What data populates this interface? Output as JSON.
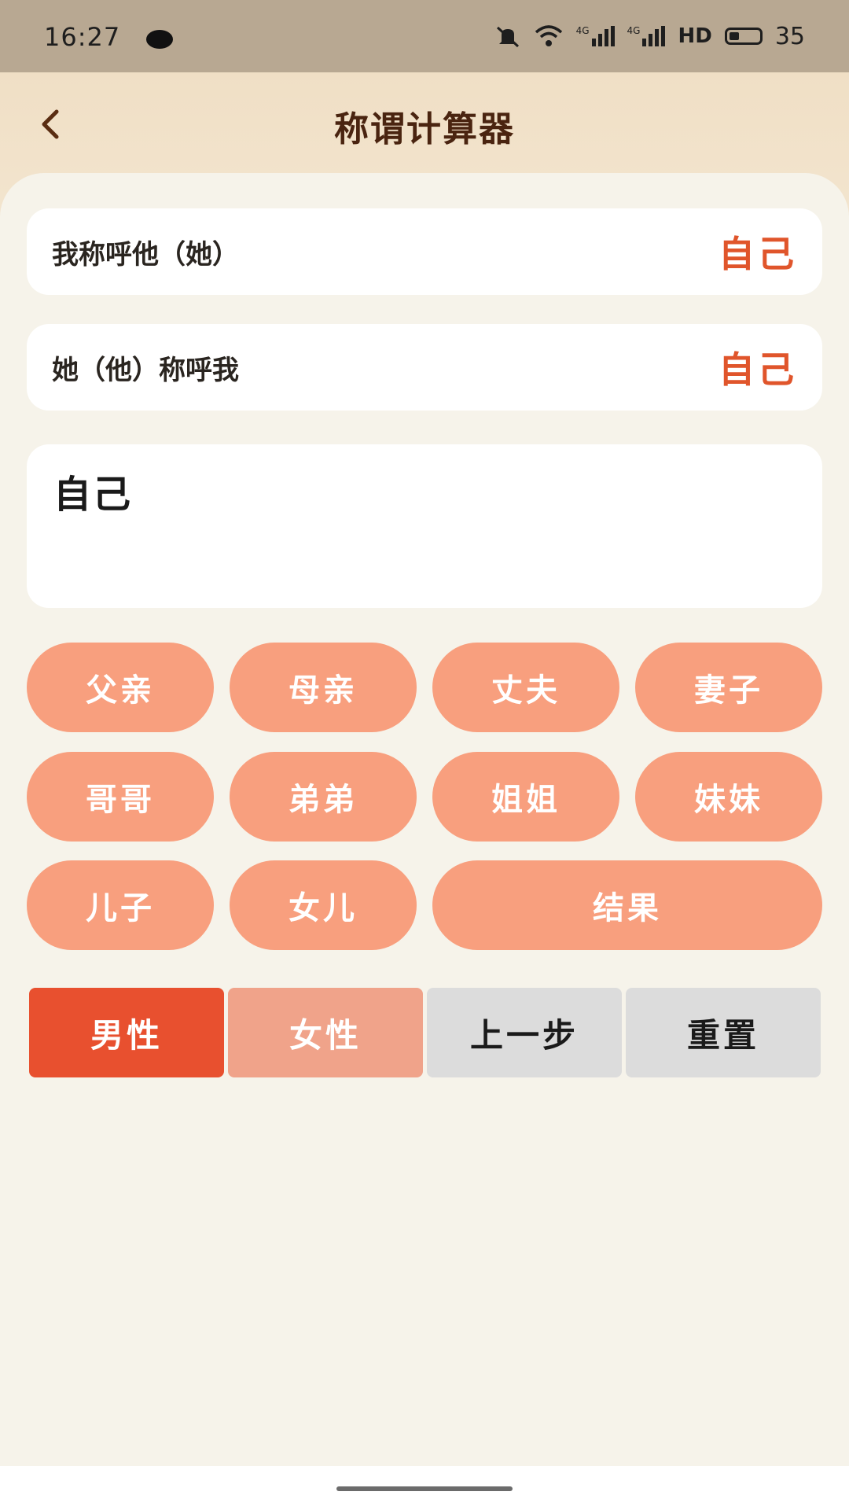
{
  "status_bar": {
    "time": "16:27",
    "network_1": "4G",
    "network_2": "4G",
    "hd": "HD",
    "battery": "35"
  },
  "header": {
    "title": "称谓计算器"
  },
  "rows": [
    {
      "label": "我称呼他（她）",
      "value": "自己"
    },
    {
      "label": "她（他）称呼我",
      "value": "自己"
    }
  ],
  "result": "自己",
  "relations": [
    "父亲",
    "母亲",
    "丈夫",
    "妻子",
    "哥哥",
    "弟弟",
    "姐姐",
    "妹妹",
    "儿子",
    "女儿"
  ],
  "result_button": "结果",
  "controls": {
    "male": "男性",
    "female": "女性",
    "prev_step": "上一步",
    "reset": "重置"
  },
  "colors": {
    "accent": "#e0552b",
    "pill": "#f89f7e",
    "male_active": "#e8502f",
    "female": "#f0a38a",
    "neutral": "#dcdcdc"
  }
}
